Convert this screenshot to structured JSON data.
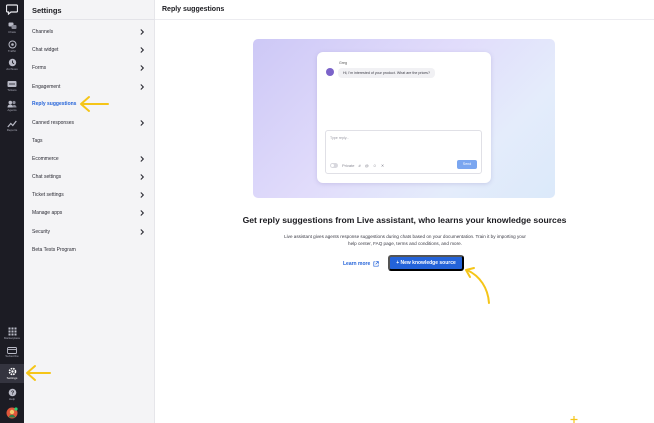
{
  "rail": {
    "items": [
      {
        "label": "Chats",
        "icon": "chat-bubble-icon"
      },
      {
        "label": "Traffic",
        "icon": "traffic-icon"
      },
      {
        "label": "Archives",
        "icon": "clock-icon"
      },
      {
        "label": "Tickets",
        "icon": "ticket-icon"
      },
      {
        "label": "Agents",
        "icon": "agents-icon"
      },
      {
        "label": "Reports",
        "icon": "reports-icon"
      },
      {
        "label": "Marketplace",
        "icon": "grid-icon"
      },
      {
        "label": "Subscribe",
        "icon": "subscribe-icon"
      },
      {
        "label": "Settings",
        "icon": "gear-icon"
      },
      {
        "label": "Help",
        "icon": "help-icon"
      }
    ]
  },
  "sidebar": {
    "title": "Settings",
    "items": [
      {
        "label": "Channels",
        "chevron": true
      },
      {
        "label": "Chat widget",
        "chevron": true
      },
      {
        "label": "Forms",
        "chevron": true
      },
      {
        "label": "Engagement",
        "chevron": true
      },
      {
        "label": "Reply suggestions",
        "chevron": false,
        "active": true
      },
      {
        "label": "Canned responses",
        "chevron": true
      },
      {
        "label": "Tags",
        "chevron": false
      },
      {
        "label": "Ecommerce",
        "chevron": true
      },
      {
        "label": "Chat settings",
        "chevron": true
      },
      {
        "label": "Ticket settings",
        "chevron": true
      },
      {
        "label": "Manage apps",
        "chevron": true
      },
      {
        "label": "Security",
        "chevron": true
      },
      {
        "label": "Beta Tests Program",
        "chevron": false
      }
    ]
  },
  "main": {
    "title": "Reply suggestions",
    "illustration": {
      "sender": "Greg",
      "message": "Hi, I'm interested of your product. What are the prices?",
      "reply_placeholder": "Type reply...",
      "private_label": "Private",
      "tool_hash": "#",
      "tool_at": "@",
      "tool_emoji": "☺",
      "tool_magic": "✕",
      "send_label": "Send"
    },
    "headline": "Get reply suggestions from Live assistant, who learns your knowledge sources",
    "description": "Live assistant gives agents response suggestions during chats based on your documentation. Train it by importing your help center, FAQ page, terms and conditions, and more.",
    "learn_more": "Learn more",
    "new_source_button": "+ New knowledge source"
  },
  "colors": {
    "accent": "#2463d9",
    "rail_bg": "#1c1c24",
    "sidebar_bg": "#f4f4f6",
    "annotation": "#f5c518"
  }
}
